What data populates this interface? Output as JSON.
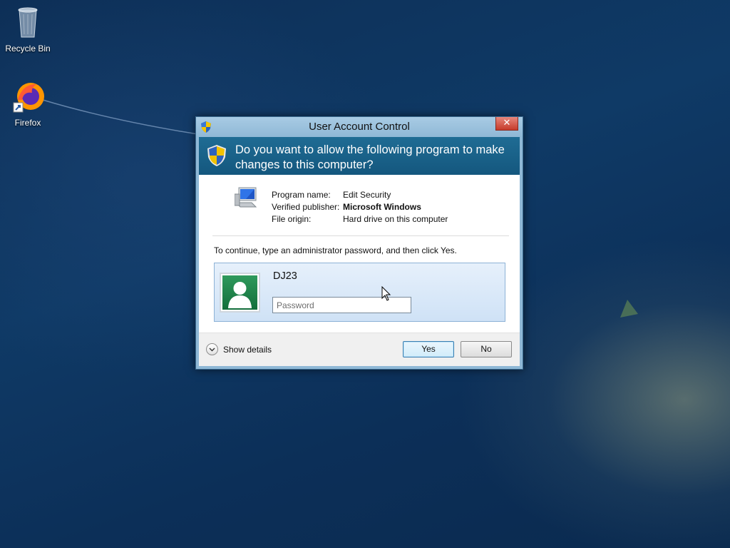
{
  "desktop": {
    "icons": [
      {
        "label": "Recycle Bin",
        "icon": "recycle-bin-icon"
      },
      {
        "label": "Firefox",
        "icon": "firefox-icon"
      }
    ]
  },
  "dialog": {
    "title": "User Account Control",
    "close_label": "✕",
    "question": "Do you want to allow the following program to make changes to this computer?",
    "program_info": {
      "name_label": "Program name:",
      "name_value": "Edit Security",
      "publisher_label": "Verified publisher:",
      "publisher_value": "Microsoft Windows",
      "origin_label": "File origin:",
      "origin_value": "Hard drive on this computer"
    },
    "instruction": "To continue, type an administrator password, and then click Yes.",
    "credential": {
      "username": "DJ23",
      "password_placeholder": "Password",
      "password_value": ""
    },
    "footer": {
      "show_details_label": "Show details",
      "yes_label": "Yes",
      "no_label": "No"
    }
  },
  "colors": {
    "banner": "#1f6c94",
    "titlebar": "#a8cbe4",
    "close": "#c63b2b",
    "avatar": "#2f9a5c"
  }
}
